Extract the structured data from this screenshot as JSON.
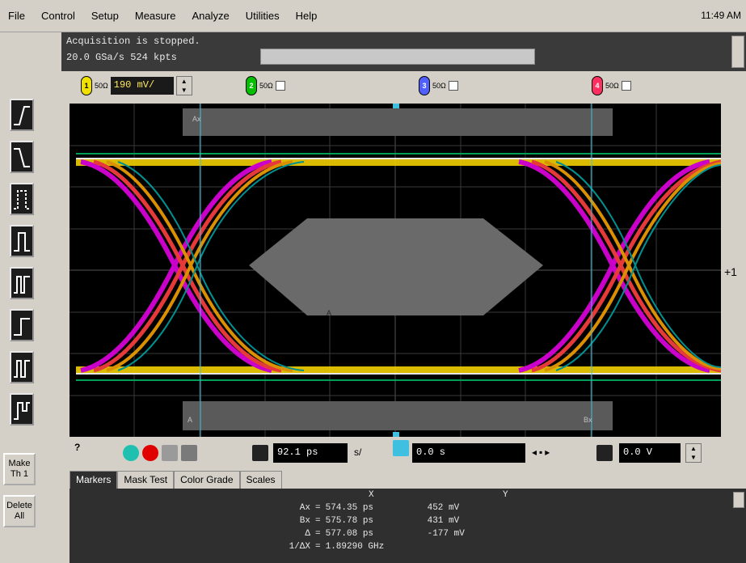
{
  "menu": {
    "items": [
      "File",
      "Control",
      "Setup",
      "Measure",
      "Analyze",
      "Utilities",
      "Help"
    ],
    "clock": "11:49 AM"
  },
  "status": {
    "line1": "Acquisition is stopped.",
    "line2": "20.0 GSa/s    524 kpts"
  },
  "channels": [
    {
      "num": "1",
      "color": "#f0e000",
      "scale": "190 mV/",
      "tag": "50Ω"
    },
    {
      "num": "2",
      "color": "#00c000",
      "tag": "50Ω"
    },
    {
      "num": "3",
      "color": "#5060ff",
      "tag": "50Ω"
    },
    {
      "num": "4",
      "color": "#ff3060",
      "tag": "50Ω"
    }
  ],
  "sidebar": {
    "make_label": "Make\nTh 1",
    "delete_label": "Delete\nAll"
  },
  "scope": {
    "marker_top": "Ax",
    "marker_bottom_left": "A",
    "marker_bottom_right": "Bx",
    "mask_label": "A",
    "right_marker": "+1"
  },
  "controls": {
    "time_value": "92.1 ps",
    "time_unit": "s/",
    "delay_value": "0.0 s",
    "trig_value": "0.0 V"
  },
  "tabs": [
    "Markers",
    "Mask Test",
    "Color Grade",
    "Scales"
  ],
  "measurements": {
    "col_x_header": "X",
    "col_y_header": "Y",
    "rows": [
      {
        "label": "Ax",
        "x": "574.35 ps",
        "y": "452 mV"
      },
      {
        "label": "Bx",
        "x": "575.78 ps",
        "y": "431 mV"
      },
      {
        "label": "Δ",
        "x": "577.08 ps",
        "y": "-177 mV"
      },
      {
        "label": "1/ΔX",
        "x": "1.89290 GHz",
        "y": ""
      }
    ]
  }
}
